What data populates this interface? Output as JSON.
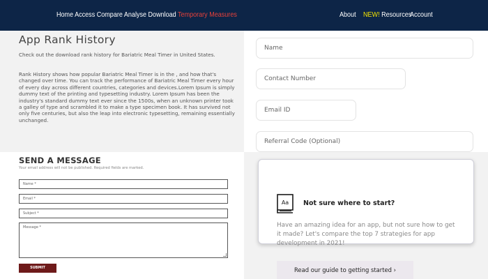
{
  "header": {
    "nav_left": [
      {
        "label": "Home"
      },
      {
        "label": "Access"
      },
      {
        "label": "Compare"
      },
      {
        "label": "Analyse"
      },
      {
        "label": "Download"
      },
      {
        "label": "Temporary Measures",
        "color": "#e8413a"
      }
    ],
    "nav_right": {
      "about": "About",
      "new_badge": "NEW!",
      "resources": "Resources",
      "account": "Account"
    },
    "background_color": "#0d2547",
    "new_badge_color": "#f6e500"
  },
  "rank_history": {
    "title": "App Rank History",
    "intro": "Check out the download rank history for Bariatric Meal Timer in United States.",
    "body": "Rank History shows how popular Bariatric Meal Timer is in the , and how that's changed over time. You can track the performance of Bariatric Meal Timer every hour of every day across different countries, categories and devices.Lorem Ipsum is simply dummy text of the printing and typesetting industry. Lorem Ipsum has been the industry's standard dummy text ever since the 1500s, when an unknown printer took a galley of type and scrambled it to make a type specimen book. It has survived not only five centuries, but also the leap into electronic typesetting, remaining essentially unchanged."
  },
  "message_form": {
    "title": "SEND A MESSAGE",
    "note": "Your email address will not be published. Required fields are marked.",
    "name_placeholder": "Name *",
    "email_placeholder": "Email *",
    "subject_placeholder": "Subject *",
    "message_placeholder": "Message *",
    "submit_label": "SUBMIT",
    "submit_color": "#6e1a1a"
  },
  "contact_form": {
    "name_placeholder": "Name",
    "contact_placeholder": "Contact Number",
    "email_placeholder": "Email ID",
    "referral_placeholder": "Referral Code (Optional)"
  },
  "guide_card": {
    "icon": "book-icon",
    "icon_text": "Aa",
    "title": "Not sure where to start?",
    "text": "Have an amazing idea for an app, but not sure how to get it made? Let's compare the top 7 strategies for app development in 2021!",
    "button_label": "Read our guide to getting started ›"
  }
}
